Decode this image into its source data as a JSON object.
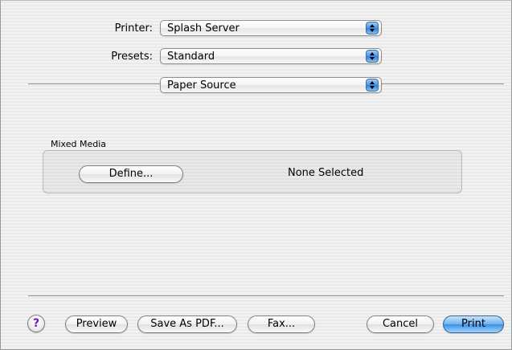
{
  "printer": {
    "label": "Printer:",
    "value": "Splash Server"
  },
  "presets": {
    "label": "Presets:",
    "value": "Standard"
  },
  "panel": {
    "value": "Paper Source"
  },
  "mixed_media": {
    "group_label": "Mixed Media",
    "define_label": "Define...",
    "status_text": "None Selected"
  },
  "footer": {
    "help_label": "?",
    "preview_label": "Preview",
    "save_pdf_label": "Save As PDF...",
    "fax_label": "Fax...",
    "cancel_label": "Cancel",
    "print_label": "Print"
  },
  "icons": {
    "popup_arrows": "up-down-arrows-icon",
    "help": "help-icon"
  },
  "colors": {
    "accent_blue": "#3c8fe4",
    "help_purple": "#6a1fa8"
  }
}
